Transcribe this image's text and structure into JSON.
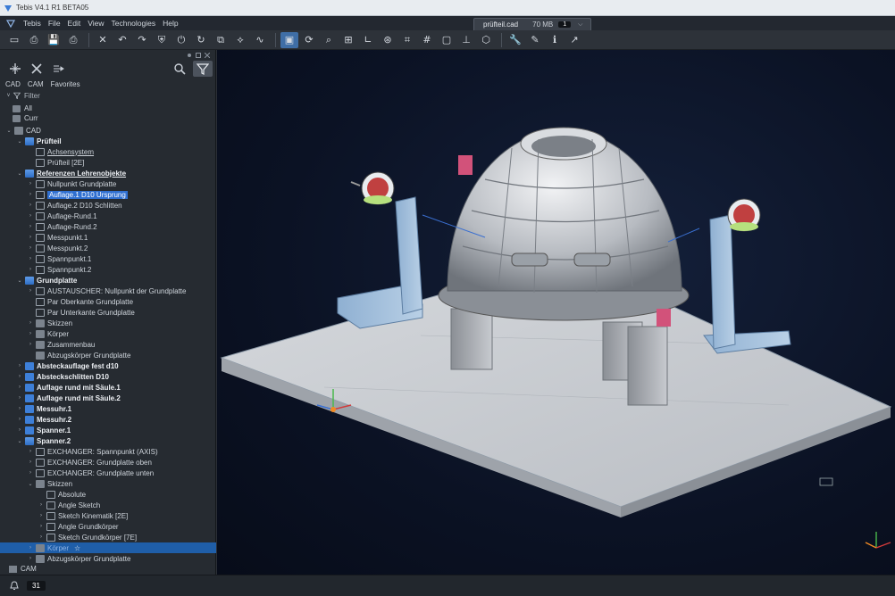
{
  "window": {
    "title": "Tebis V4.1 R1 BETA05"
  },
  "menu": {
    "items": [
      "Tebis",
      "File",
      "Edit",
      "View",
      "Technologies",
      "Help"
    ]
  },
  "file_tab": {
    "name": "prüfteil.cad",
    "size": "70 MB",
    "count": "1"
  },
  "panel": {
    "tabs": [
      "CAD",
      "CAM",
      "Favorites"
    ],
    "filter_label": "Filter",
    "quick": [
      {
        "label": "All"
      },
      {
        "label": "Curr"
      }
    ],
    "tree": [
      {
        "label": "CAD",
        "depth": 0,
        "arrow": "v",
        "icon": "grey",
        "style": ""
      },
      {
        "label": "Prüfteil",
        "depth": 1,
        "arrow": "v",
        "icon": "folder-open",
        "style": "bold"
      },
      {
        "label": "Achsensystem",
        "depth": 2,
        "arrow": "",
        "icon": "node",
        "style": "ul"
      },
      {
        "label": "Prüfteil [2E]",
        "depth": 2,
        "arrow": "",
        "icon": "node",
        "style": ""
      },
      {
        "label": "Referenzen Lehrenobjekte",
        "depth": 1,
        "arrow": "v",
        "icon": "folder-open",
        "style": "bold ul"
      },
      {
        "label": "Nullpunkt Grundplatte",
        "depth": 2,
        "arrow": ">",
        "icon": "node",
        "style": ""
      },
      {
        "label": "Auflage.1 D10 Ursprung",
        "depth": 2,
        "arrow": ">",
        "icon": "node",
        "style": "sel"
      },
      {
        "label": "Auflage.2 D10 Schlitten",
        "depth": 2,
        "arrow": ">",
        "icon": "node",
        "style": ""
      },
      {
        "label": "Auflage-Rund.1",
        "depth": 2,
        "arrow": ">",
        "icon": "node",
        "style": ""
      },
      {
        "label": "Auflage-Rund.2",
        "depth": 2,
        "arrow": ">",
        "icon": "node",
        "style": ""
      },
      {
        "label": "Messpunkt.1",
        "depth": 2,
        "arrow": ">",
        "icon": "node",
        "style": ""
      },
      {
        "label": "Messpunkt.2",
        "depth": 2,
        "arrow": ">",
        "icon": "node",
        "style": ""
      },
      {
        "label": "Spannpunkt.1",
        "depth": 2,
        "arrow": ">",
        "icon": "node",
        "style": ""
      },
      {
        "label": "Spannpunkt.2",
        "depth": 2,
        "arrow": ">",
        "icon": "node",
        "style": ""
      },
      {
        "label": "Grundplatte",
        "depth": 1,
        "arrow": "v",
        "icon": "folder-open",
        "style": "bold"
      },
      {
        "label": "AUSTAUSCHER: Nullpunkt der Grundplatte",
        "depth": 2,
        "arrow": ">",
        "icon": "node",
        "style": ""
      },
      {
        "label": "Par Oberkante Grundplatte",
        "depth": 2,
        "arrow": "",
        "icon": "node",
        "style": ""
      },
      {
        "label": "Par Unterkante Grundplatte",
        "depth": 2,
        "arrow": "",
        "icon": "node",
        "style": ""
      },
      {
        "label": "Skizzen",
        "depth": 2,
        "arrow": ">",
        "icon": "grey",
        "style": ""
      },
      {
        "label": "Körper",
        "depth": 2,
        "arrow": ">",
        "icon": "grey",
        "style": ""
      },
      {
        "label": "Zusammenbau",
        "depth": 2,
        "arrow": ">",
        "icon": "grey",
        "style": ""
      },
      {
        "label": "Abzugskörper Grundplatte",
        "depth": 2,
        "arrow": "",
        "icon": "grey",
        "style": ""
      },
      {
        "label": "Absteckauflage fest d10",
        "depth": 1,
        "arrow": ">",
        "icon": "folder",
        "style": "bold"
      },
      {
        "label": "Absteckschlitten D10",
        "depth": 1,
        "arrow": ">",
        "icon": "folder",
        "style": "bold"
      },
      {
        "label": "Auflage rund mit Säule.1",
        "depth": 1,
        "arrow": ">",
        "icon": "folder",
        "style": "bold"
      },
      {
        "label": "Auflage rund mit Säule.2",
        "depth": 1,
        "arrow": ">",
        "icon": "folder",
        "style": "bold"
      },
      {
        "label": "Messuhr.1",
        "depth": 1,
        "arrow": ">",
        "icon": "folder",
        "style": "bold"
      },
      {
        "label": "Messuhr.2",
        "depth": 1,
        "arrow": ">",
        "icon": "folder",
        "style": "bold"
      },
      {
        "label": "Spanner.1",
        "depth": 1,
        "arrow": ">",
        "icon": "folder",
        "style": "bold"
      },
      {
        "label": "Spanner.2",
        "depth": 1,
        "arrow": "v",
        "icon": "folder-open",
        "style": "bold"
      },
      {
        "label": "EXCHANGER: Spannpunkt (AXIS)",
        "depth": 2,
        "arrow": ">",
        "icon": "node",
        "style": ""
      },
      {
        "label": "EXCHANGER: Grundplatte oben",
        "depth": 2,
        "arrow": ">",
        "icon": "node",
        "style": ""
      },
      {
        "label": "EXCHANGER: Grundplatte unten",
        "depth": 2,
        "arrow": ">",
        "icon": "node",
        "style": ""
      },
      {
        "label": "Skizzen",
        "depth": 2,
        "arrow": "v",
        "icon": "grey",
        "style": ""
      },
      {
        "label": "Absolute",
        "depth": 3,
        "arrow": "",
        "icon": "node",
        "style": ""
      },
      {
        "label": "Angle Sketch",
        "depth": 3,
        "arrow": ">",
        "icon": "node",
        "style": ""
      },
      {
        "label": "Sketch Kinematik [2E]",
        "depth": 3,
        "arrow": ">",
        "icon": "node",
        "style": ""
      },
      {
        "label": "Angle Grundkörper",
        "depth": 3,
        "arrow": ">",
        "icon": "node",
        "style": ""
      },
      {
        "label": "Sketch Grundkörper [7E]",
        "depth": 3,
        "arrow": ">",
        "icon": "node",
        "style": ""
      },
      {
        "label": "Körper",
        "depth": 2,
        "arrow": ">",
        "icon": "grey",
        "style": "selected",
        "star": "☆"
      },
      {
        "label": "Abzugskörper Grundplatte",
        "depth": 2,
        "arrow": ">",
        "icon": "grey",
        "style": ""
      }
    ],
    "cam_label": "CAM"
  },
  "toolbar": {
    "icons": [
      "open-icon",
      "import-icon",
      "save-icon",
      "print-icon",
      "delete-icon",
      "undo-icon",
      "redo-icon",
      "select-icon",
      "power-icon",
      "refresh-icon",
      "layer-icon",
      "measure-icon",
      "sketch-icon",
      "view-cube-icon",
      "rotate-icon",
      "zoom-icon",
      "fit-icon",
      "axis-icon",
      "orbit-icon",
      "analysis-icon",
      "grid-icon",
      "frame-icon",
      "plane-icon",
      "box-icon",
      "wrench-icon",
      "brush-icon",
      "info-icon",
      "pointer-icon"
    ]
  },
  "status": {
    "count": "31"
  },
  "colors": {
    "selection": "#1f5ea8",
    "accent": "#2f6fd0",
    "viewport_bg": "#0b1224"
  }
}
